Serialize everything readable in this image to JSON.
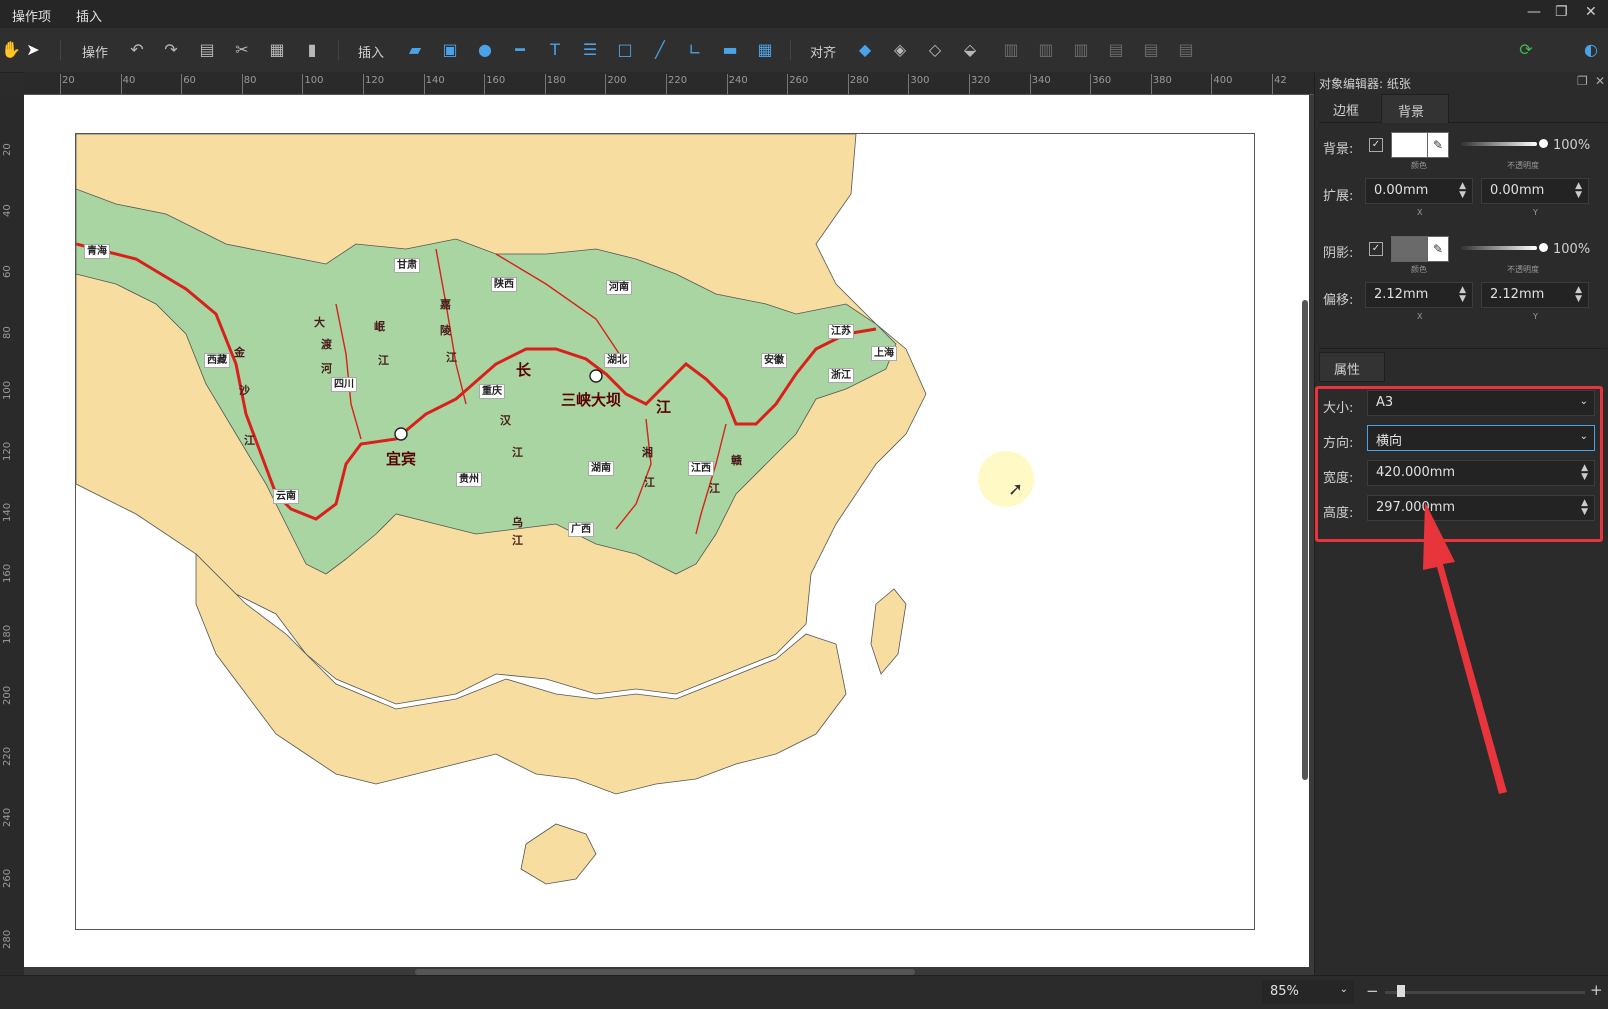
{
  "menu": {
    "items": [
      "操作项",
      "插入"
    ]
  },
  "window": {
    "minimize": "—",
    "restore": "❐",
    "close": "✕"
  },
  "toolbar": {
    "operate_label": "操作",
    "insert_label": "插入",
    "align_label": "对齐"
  },
  "ruler": {
    "h_labels": [
      "20",
      "40",
      "60",
      "80",
      "100",
      "120",
      "140",
      "160",
      "180",
      "200",
      "220",
      "240",
      "260",
      "280",
      "300",
      "320",
      "340",
      "360",
      "380",
      "400",
      "42"
    ],
    "v_labels": [
      "20",
      "40",
      "60",
      "80",
      "100",
      "120",
      "140",
      "160",
      "180",
      "200",
      "220",
      "240",
      "260",
      "280"
    ]
  },
  "map": {
    "provinces": [
      "青海",
      "甘肃",
      "陕西",
      "河南",
      "西藏",
      "四川",
      "重庆",
      "湖北",
      "安徽",
      "江苏",
      "上海",
      "浙江",
      "贵州",
      "湖南",
      "江西",
      "云南",
      "广西"
    ],
    "river_chars": [
      "金",
      "沙",
      "江",
      "大",
      "渡",
      "河",
      "岷",
      "江",
      "嘉",
      "陵",
      "江",
      "汉",
      "江",
      "湘",
      "江",
      "赣",
      "江",
      "乌",
      "江"
    ],
    "big_labels": [
      "长",
      "江",
      "宜宾",
      "三峡大坝"
    ]
  },
  "panel": {
    "title": "对象编辑器: 纸张",
    "tabs": [
      "边框",
      "背景"
    ],
    "active_tab": "背景",
    "background": {
      "label": "背景:",
      "color_caption": "颜色",
      "opacity": "100%",
      "opacity_caption": "不透明度",
      "checked": true,
      "color": "#ffffff"
    },
    "extend": {
      "label": "扩展:",
      "x": "0.00mm",
      "y": "0.00mm",
      "x_caption": "X",
      "y_caption": "Y"
    },
    "shadow": {
      "label": "阴影:",
      "color_caption": "颜色",
      "opacity": "100%",
      "opacity_caption": "不透明度",
      "checked": true,
      "color": "#6a6a6a"
    },
    "offset": {
      "label": "偏移:",
      "x": "2.12mm",
      "y": "2.12mm",
      "x_caption": "X",
      "y_caption": "Y"
    },
    "properties_tab": "属性",
    "size": {
      "label": "大小:",
      "value": "A3"
    },
    "orientation": {
      "label": "方向:",
      "value": "横向"
    },
    "width": {
      "label": "宽度:",
      "value": "420.000mm"
    },
    "height": {
      "label": "高度:",
      "value": "297.000mm"
    }
  },
  "status": {
    "zoom": "85%",
    "minus": "−",
    "plus": "+",
    "zoom_level": 0.06
  },
  "colors": {
    "highlight_red": "#e8353b",
    "land_green": "#a8d5a2",
    "land_yellow": "#f7dda0",
    "river_red": "#d9201b"
  }
}
